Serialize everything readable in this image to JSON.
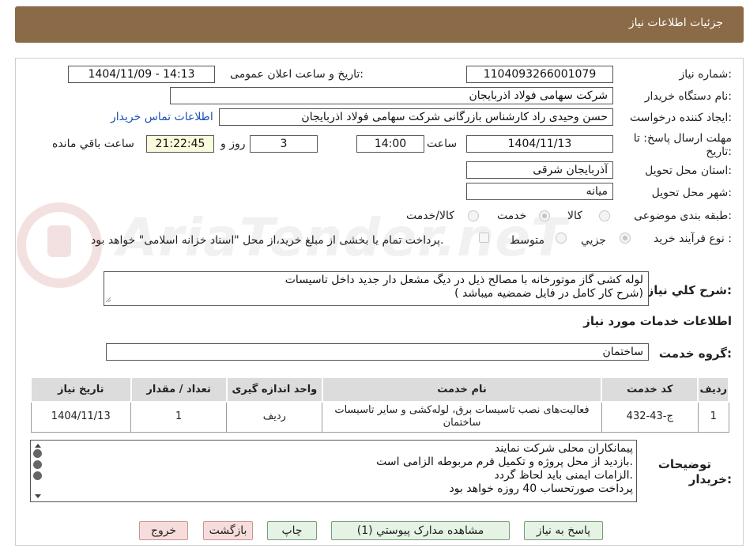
{
  "header": {
    "title": "جزئیات اطلاعات نیاز"
  },
  "watermark": {
    "text": "AriaTender.neT"
  },
  "need_number": {
    "label": "شماره نیاز:",
    "value": "1104093266001079"
  },
  "announce": {
    "label": "تاریخ و ساعت اعلان عمومی:",
    "value": "1404/11/09 - 14:13"
  },
  "buyer_org": {
    "label": "نام دستگاه خریدار:",
    "value": "شرکت سهامی فولاد اذربایجان"
  },
  "requester": {
    "label": "ایجاد کننده درخواست:",
    "value": "حسن وحیدی راد کارشناس بازرگانی شرکت سهامی فولاد اذربایجان",
    "contact_link": "اطلاعات تماس خریدار"
  },
  "deadline": {
    "label_line1": "مهلت ارسال پاسخ: تا",
    "label_line2": "تاریخ:",
    "date": "1404/11/13",
    "time_label": "ساعت",
    "time": "14:00",
    "days": "3",
    "days_label": "روز و",
    "remaining": "21:22:45",
    "remaining_label": "ساعت باقي مانده"
  },
  "province": {
    "label": "استان محل تحویل:",
    "value": "آذربایجان شرقی"
  },
  "city": {
    "label": "شهر محل تحویل:",
    "value": "میانه"
  },
  "category": {
    "label": "طبقه بندی موضوعی:",
    "options": [
      "کالا",
      "خدمت",
      "کالا/خدمت"
    ],
    "selected": "خدمت"
  },
  "process": {
    "label": "نوع فرآیند خرید :",
    "options": [
      "جزیي",
      "متوسط"
    ],
    "selected": "جزیي",
    "note": "پرداخت تمام یا بخشی از مبلغ خرید،از محل \"اسناد خزانه اسلامی\" خواهد بود."
  },
  "description": {
    "label": "شرح کلي نیاز:",
    "line1": "لوله کشی گاز موتورخانه با مصالح ذیل در دیگ مشعل دار جدید داخل تاسیسات",
    "line2": "( شرح کار کامل در فایل ضمضیه میباشد)"
  },
  "services_section": {
    "title": "اطلاعات خدمات مورد نیاز"
  },
  "service_group": {
    "label": "گروه خدمت:",
    "value": "ساختمان"
  },
  "table": {
    "headers": [
      "ردیف",
      "کد خدمت",
      "نام خدمت",
      "واحد اندازه گیری",
      "تعداد / مقدار",
      "تاریخ نیاز"
    ],
    "rows": [
      {
        "row": "1",
        "code": "ج-43-432",
        "name_line1": "فعالیت‌های نصب تاسیسات برق، لوله‌کشی و سایر تاسیسات",
        "name_line2": "ساختمان",
        "unit": "ردیف",
        "qty": "1",
        "date": "1404/11/13"
      }
    ]
  },
  "buyer_notes": {
    "label_line1": "توضیحات",
    "label_line2": "خریدار:",
    "lines": [
      "پیمانکاران محلی شرکت نمایند",
      "بازدید از محل پروژه و تکمیل فرم مربوطه الزامی است.",
      "الزامات ایمنی باید لحاظ گردد.",
      "پرداخت صورتحساب 40 روزه خواهد بود"
    ]
  },
  "buttons": {
    "reply": "پاسخ به نیاز",
    "attachments": "مشاهده مدارک پیوستي (1)",
    "print": "چاپ",
    "back": "بازگشت",
    "exit": "خروج"
  }
}
